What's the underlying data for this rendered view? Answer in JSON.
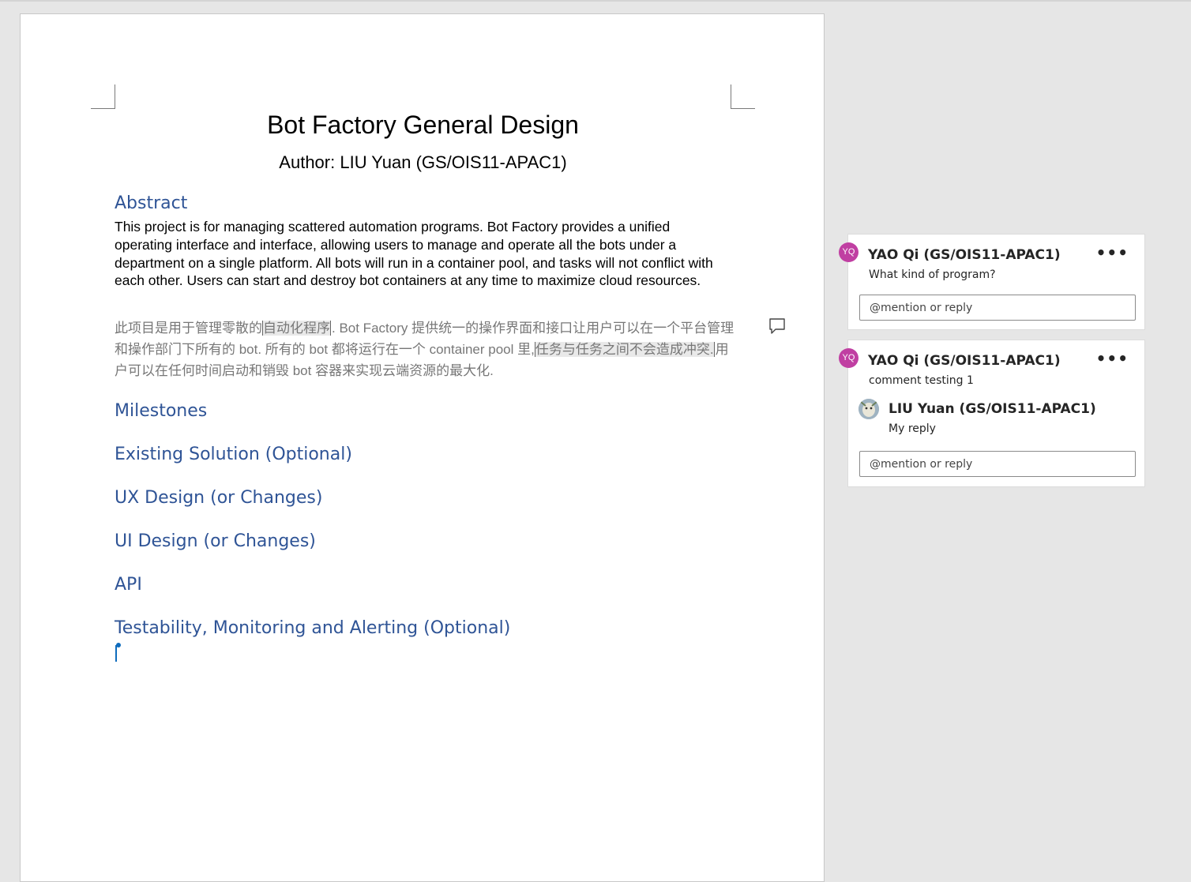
{
  "document": {
    "title": "Bot Factory General Design",
    "author": "Author: LIU Yuan (GS/OIS11-APAC1)",
    "headings": {
      "abstract": "Abstract",
      "milestones": "Milestones",
      "existing_solution": "Existing Solution (Optional)",
      "ux_design": "UX Design (or Changes)",
      "ui_design": "UI Design (or Changes)",
      "api": "API",
      "testability": "Testability, Monitoring and Alerting (Optional)"
    },
    "abstract_text": "This project is for managing scattered automation programs. Bot Factory provides a unified operating interface and interface, allowing users to manage and operate all the bots under a department on a single platform. All bots will run in a container pool, and tasks will not conflict with each other. Users can start and destroy bot containers at any time to maximize cloud resources.",
    "chinese_text": {
      "part1": "此项目是用于管理零散的",
      "highlight1": "自动化程序",
      "part2": ". Bot Factory 提供统一的操作界面和接口让用户可以在一个平台管理和操作部门下所有的 bot. 所有的 bot 都将运行在一个 container pool 里,",
      "highlight2": "任务与任务之间不会造成冲突.",
      "part3": "用户可以在任何时间启动和销毁 bot 容器来实现云端资源的最大化."
    }
  },
  "comments": [
    {
      "author_initials": "YQ",
      "author": "YAO Qi (GS/OIS11-APAC1)",
      "text": "What kind of program?",
      "reply_placeholder": "@mention or reply"
    },
    {
      "author_initials": "YQ",
      "author": "YAO Qi (GS/OIS11-APAC1)",
      "text": "comment testing 1",
      "reply": {
        "author": "LIU Yuan (GS/OIS11-APAC1)",
        "text": "My reply"
      },
      "reply_placeholder": "@mention or reply"
    }
  ],
  "ui": {
    "more_options": "•••"
  },
  "colors": {
    "heading": "#2f5496",
    "avatar_yq": "#c03fa2",
    "cursor": "#0f6cbd"
  }
}
